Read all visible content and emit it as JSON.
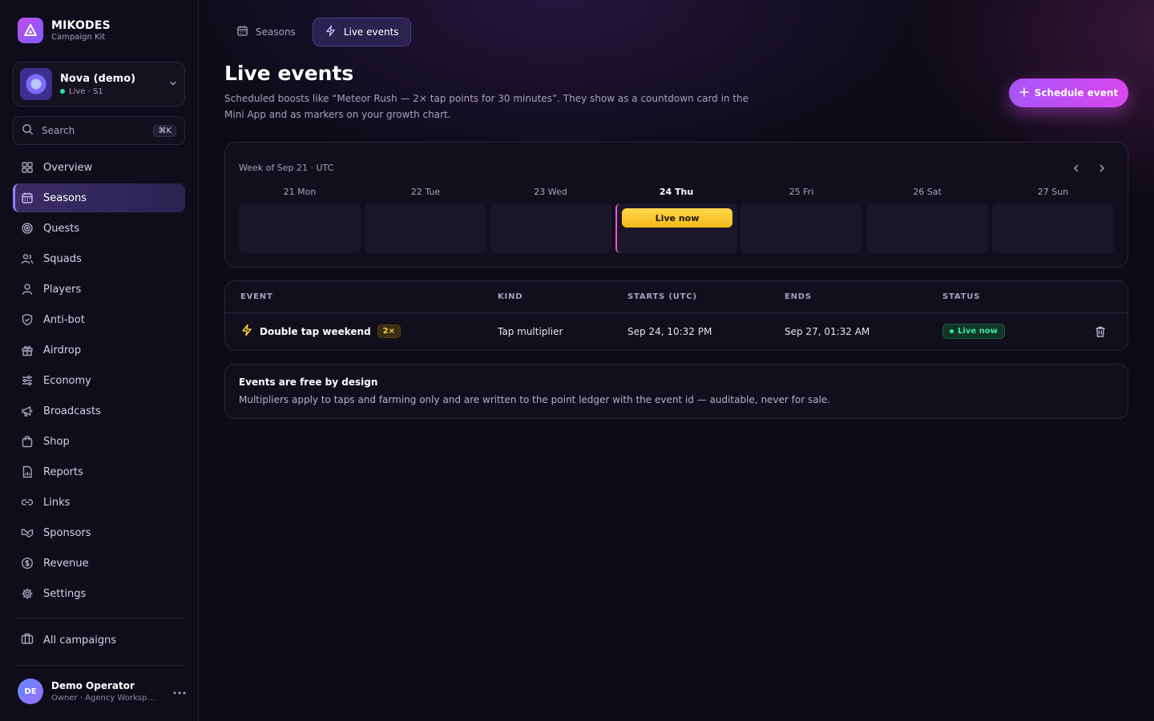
{
  "brand": {
    "name": "MIKODES",
    "subtitle": "Campaign Kit"
  },
  "campaign": {
    "name": "Nova (demo)",
    "status": "Live · S1"
  },
  "search": {
    "placeholder": "Search",
    "shortcut": "⌘K"
  },
  "nav": {
    "items": [
      {
        "label": "Overview",
        "icon": "grid-icon"
      },
      {
        "label": "Seasons",
        "icon": "calendar-icon",
        "active": true
      },
      {
        "label": "Quests",
        "icon": "target-icon"
      },
      {
        "label": "Squads",
        "icon": "users-icon"
      },
      {
        "label": "Players",
        "icon": "user-icon"
      },
      {
        "label": "Anti-bot",
        "icon": "shield-icon"
      },
      {
        "label": "Airdrop",
        "icon": "gift-icon"
      },
      {
        "label": "Economy",
        "icon": "sliders-icon"
      },
      {
        "label": "Broadcasts",
        "icon": "megaphone-icon"
      },
      {
        "label": "Shop",
        "icon": "bag-icon"
      },
      {
        "label": "Reports",
        "icon": "report-icon"
      },
      {
        "label": "Links",
        "icon": "link-icon"
      },
      {
        "label": "Sponsors",
        "icon": "handshake-icon"
      },
      {
        "label": "Revenue",
        "icon": "dollar-icon"
      },
      {
        "label": "Settings",
        "icon": "gear-icon"
      }
    ],
    "all_campaigns": "All campaigns"
  },
  "user": {
    "initials": "DE",
    "name": "Demo Operator",
    "role": "Owner · Agency Workspace"
  },
  "tabs": [
    {
      "label": "Seasons"
    },
    {
      "label": "Live events",
      "active": true
    }
  ],
  "page": {
    "title": "Live events",
    "description": "Scheduled boosts like “Meteor Rush — 2× tap points for 30 minutes”. They show as a countdown card in the Mini App and as markers on your growth chart.",
    "primary_action": "Schedule event"
  },
  "calendar": {
    "week_label": "Week of Sep 21 · UTC",
    "days": [
      "21 Mon",
      "22 Tue",
      "23 Wed",
      "24 Thu",
      "25 Fri",
      "26 Sat",
      "27 Sun"
    ],
    "today": "24 Thu",
    "event_label": "Live now"
  },
  "table": {
    "headers": [
      "EVENT",
      "KIND",
      "STARTS (UTC)",
      "ENDS",
      "STATUS"
    ],
    "rows": [
      {
        "event": "Double tap weekend",
        "multiplier": "2×",
        "kind": "Tap multiplier",
        "starts": "Sep 24, 10:32 PM",
        "ends": "Sep 27, 01:32 AM",
        "status": "Live now"
      }
    ]
  },
  "info": {
    "title": "Events are free by design",
    "body": "Multipliers apply to taps and farming only and are written to the point ledger with the event id — auditable, never for sale."
  },
  "colors": {
    "accent": "#a855f7",
    "accent_pink": "#d946ef",
    "live_green": "#3fe5a0",
    "event_yellow": "#ffd84a"
  }
}
